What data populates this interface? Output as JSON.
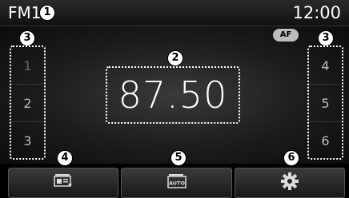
{
  "status": {
    "band": "FM1",
    "time": "12:00"
  },
  "af_label": "AF",
  "frequency": "87.50",
  "presets_left": [
    {
      "label": "1",
      "dim": true
    },
    {
      "label": "2"
    },
    {
      "label": "3"
    }
  ],
  "presets_right": [
    {
      "label": "4"
    },
    {
      "label": "5"
    },
    {
      "label": "6"
    }
  ],
  "callouts": [
    "1",
    "2",
    "3",
    "3",
    "4",
    "5",
    "6"
  ],
  "buttons": {
    "b1_icon": "preset-save-icon",
    "b2_icon": "auto-store-icon",
    "b2_text": "AUTO",
    "b3_icon": "gear-icon"
  }
}
